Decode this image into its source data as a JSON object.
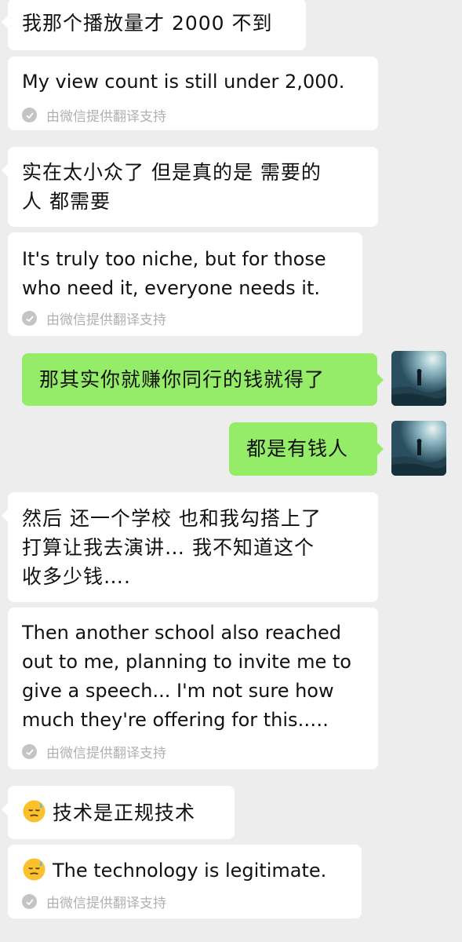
{
  "messages": {
    "m1": {
      "text": "我那个播放量才 2000 不到"
    },
    "m1_translation": {
      "text": "My view count is still under 2,000.",
      "note": "由微信提供翻译支持"
    },
    "m2": {
      "text": "实在太小众了 但是真的是 需要的\n人 都需要"
    },
    "m2_translation": {
      "text": "It's truly too niche, but for those\nwho need it, everyone needs it.",
      "note": "由微信提供翻译支持"
    },
    "m3": {
      "text": "那其实你就赚你同行的钱就得了"
    },
    "m4": {
      "text": "都是有钱人"
    },
    "m5": {
      "text": "然后 还一个学校 也和我勾搭上了\n打算让我去演讲… 我不知道这个\n收多少钱…."
    },
    "m5_translation": {
      "text": "Then another school also reached\nout to me, planning to invite me to\ngive a speech... I'm not sure how\nmuch they're offering for this.….",
      "note": "由微信提供翻译支持"
    },
    "m6": {
      "text": "技术是正规技术",
      "emoji": "sweat-emoji-icon"
    },
    "m6_translation": {
      "text": "The technology is legitimate.",
      "note": "由微信提供翻译支持",
      "emoji": "sweat-emoji-icon"
    }
  },
  "colors": {
    "background": "#ededed",
    "incoming_bubble": "#ffffff",
    "outgoing_bubble": "#95ec69",
    "note_text": "#b0b0b0"
  }
}
